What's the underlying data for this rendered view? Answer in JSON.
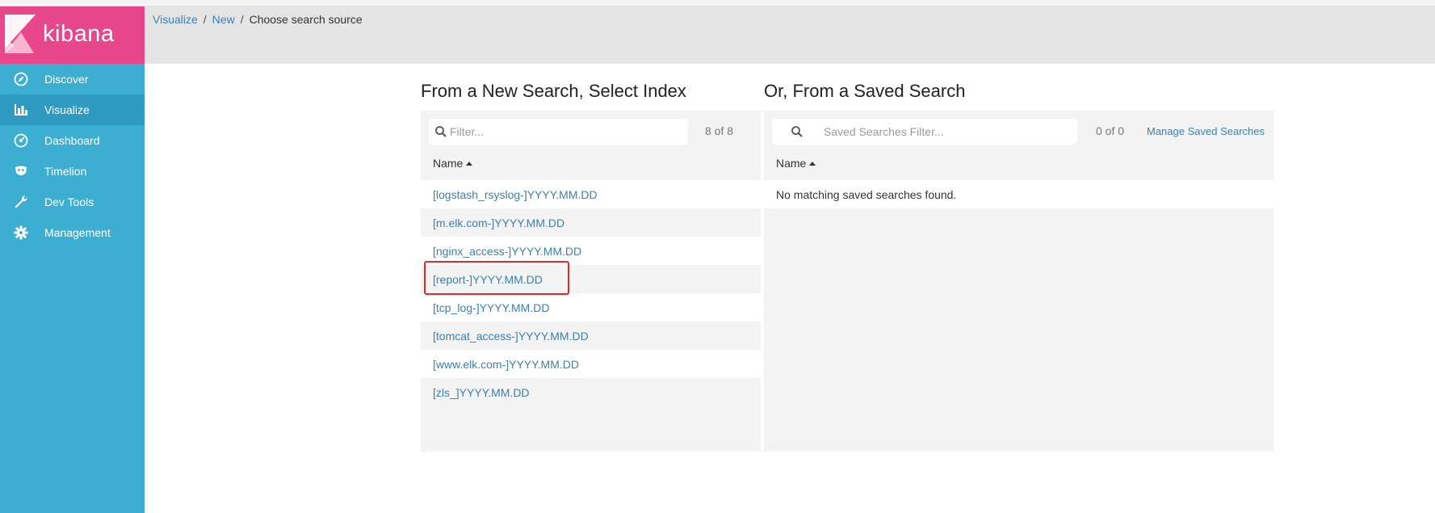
{
  "app": {
    "name": "kibana"
  },
  "colors": {
    "brand_pink": "#e8488b",
    "sidebar_blue": "#3caed2",
    "link_blue": "#3b80b0",
    "annotation_red": "#e02b2b"
  },
  "sidebar": {
    "items": [
      {
        "label": "Discover",
        "icon": "compass-icon"
      },
      {
        "label": "Visualize",
        "icon": "bar-chart-icon",
        "active": true
      },
      {
        "label": "Dashboard",
        "icon": "dashboard-gauge-icon"
      },
      {
        "label": "Timelion",
        "icon": "timelion-mask-icon"
      },
      {
        "label": "Dev Tools",
        "icon": "wrench-icon"
      },
      {
        "label": "Management",
        "icon": "gear-icon"
      }
    ]
  },
  "breadcrumb": {
    "items": [
      "Visualize",
      "New"
    ],
    "current": "Choose search source"
  },
  "new_search": {
    "title": "From a New Search, Select Index",
    "filter_placeholder": "Filter...",
    "count": "8 of 8",
    "column_header": "Name",
    "indices": [
      "[logstash_rsyslog-]YYYY.MM.DD",
      "[m.elk.com-]YYYY.MM.DD",
      "[nginx_access-]YYYY.MM.DD",
      "[report-]YYYY.MM.DD",
      "[tcp_log-]YYYY.MM.DD",
      "[tomcat_access-]YYYY.MM.DD",
      "[www.elk.com-]YYYY.MM.DD",
      "[zls_]YYYY.MM.DD"
    ]
  },
  "saved_search": {
    "title": "Or, From a Saved Search",
    "filter_placeholder": "Saved Searches Filter...",
    "count": "0 of 0",
    "manage_label": "Manage Saved Searches",
    "column_header": "Name",
    "empty_message": "No matching saved searches found."
  }
}
